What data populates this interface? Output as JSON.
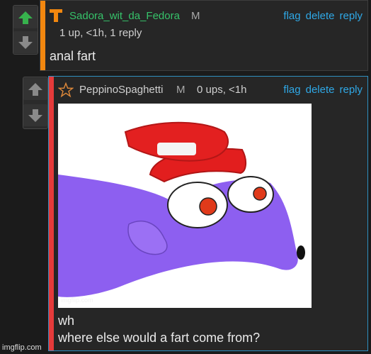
{
  "comment1": {
    "username": "Sadora_wit_da_Fedora",
    "mod_mark": "M",
    "meta": "1 up, <1h, 1 reply",
    "actions": {
      "flag": "flag",
      "delete": "delete",
      "reply": "reply"
    },
    "body": "anal fart",
    "accent_color": "#f2870f",
    "username_color": "#36c26a",
    "vote": {
      "up_icon": "arrow-up-icon",
      "down_icon": "arrow-down-icon",
      "upvoted": true
    }
  },
  "comment2": {
    "username": "PeppinoSpaghetti",
    "mod_mark": "M",
    "meta": "0 ups, <1h",
    "actions": {
      "flag": "flag",
      "delete": "delete",
      "reply": "reply"
    },
    "image_watermark": "imgflip.com",
    "body_line1": "wh",
    "body_line2": "where else would a fart come from?",
    "accent_color": "#e53a3a",
    "username_color": "#d0d0d0",
    "vote": {
      "up_icon": "arrow-up-icon",
      "down_icon": "arrow-down-icon",
      "upvoted": false
    }
  },
  "footer_watermark": "imgflip.com"
}
